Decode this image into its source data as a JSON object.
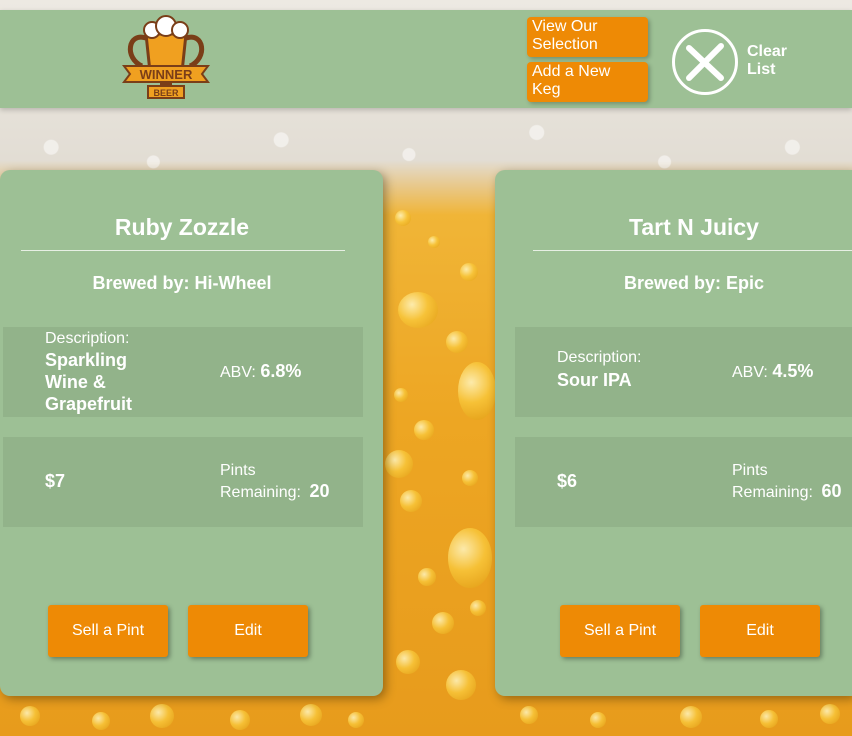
{
  "header": {
    "logo_top_text": "WINNER",
    "logo_bottom_text": "BEER",
    "view_selection_label": "View Our Selection",
    "add_keg_label": "Add a New Keg",
    "clear_list_label": "Clear List"
  },
  "kegs": [
    {
      "name": "Ruby Zozzle",
      "brewer_label": "Brewed by: Hi-Wheel",
      "description_label": "Description:",
      "description": "Sparkling Wine & Grapefruit",
      "abv_label": "ABV:",
      "abv": "6.8%",
      "price": "$7",
      "pints_label": "Pints Remaining:",
      "pints": "20",
      "sell_label": "Sell a Pint",
      "edit_label": "Edit"
    },
    {
      "name": "Tart N Juicy",
      "brewer_label": "Brewed by: Epic",
      "description_label": "Description:",
      "description": "Sour IPA",
      "abv_label": "ABV:",
      "abv": "4.5%",
      "price": "$6",
      "pints_label": "Pints Remaining:",
      "pints": "60",
      "sell_label": "Sell a Pint",
      "edit_label": "Edit"
    }
  ],
  "colors": {
    "header_green": "#9dc095",
    "row_green": "#92b38a",
    "accent_orange": "#ee8a05"
  },
  "icons": {
    "logo": "winner-beer-trophy-logo",
    "clear": "crossed-out-close-icon"
  }
}
